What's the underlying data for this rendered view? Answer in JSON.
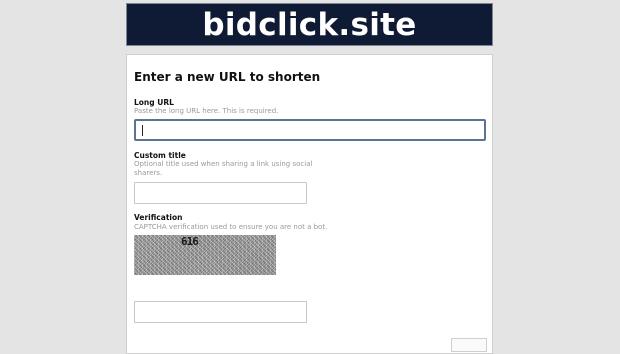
{
  "header": {
    "site_title": "bidclick.site"
  },
  "form": {
    "heading": "Enter a new URL to shorten",
    "long_url": {
      "label": "Long URL",
      "help": "Paste the long URL here. This is required.",
      "value": ""
    },
    "custom_title": {
      "label": "Custom title",
      "help": "Optional title used when sharing a link using social sharers.",
      "value": ""
    },
    "verification": {
      "label": "Verification",
      "help": "CAPTCHA verification used to ensure you are not a bot.",
      "captcha_text": "616",
      "value": ""
    }
  },
  "colors": {
    "header_bg": "#0f1a35",
    "focus_border": "#5c7491",
    "page_bg": "#e4e4e4"
  }
}
